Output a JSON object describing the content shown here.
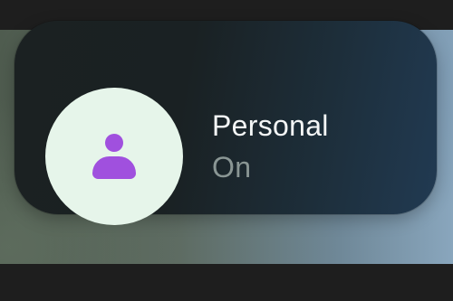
{
  "focus_tile": {
    "title": "Personal",
    "status": "On",
    "icon": "person-icon",
    "icon_color": "#a050de",
    "icon_background": "#e6f5ea"
  }
}
